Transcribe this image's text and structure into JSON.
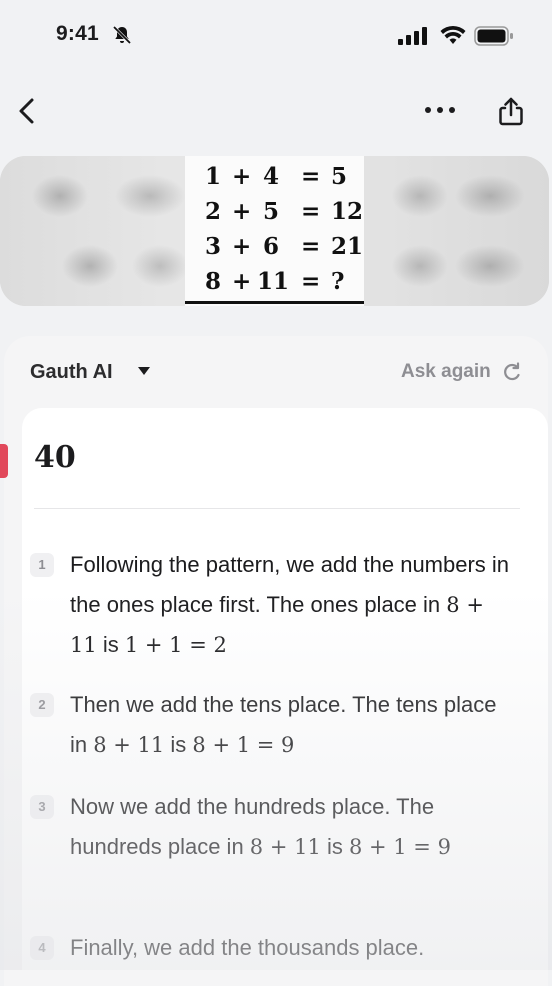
{
  "status_bar": {
    "time": "9:41"
  },
  "puzzle": {
    "lines": [
      {
        "a": "1",
        "op": "+",
        "b": "4",
        "eq": "=",
        "r": "5"
      },
      {
        "a": "2",
        "op": "+",
        "b": "5",
        "eq": "=",
        "r": "12"
      },
      {
        "a": "3",
        "op": "+",
        "b": "6",
        "eq": "=",
        "r": "21"
      },
      {
        "a": "8",
        "op": "+",
        "b": "11",
        "eq": "=",
        "r": "?"
      }
    ]
  },
  "answer_panel": {
    "model_name": "Gauth AI",
    "ask_again_label": "Ask again",
    "answer": "40",
    "steps": [
      {
        "num": "1",
        "parts": [
          "Following the pattern, we add the numbers in the ones place first. The ones place in ",
          "8 + 11",
          " is ",
          "1 + 1 = 2"
        ]
      },
      {
        "num": "2",
        "parts": [
          "Then we add the tens place. The tens place in ",
          "8 + 11",
          " is ",
          "8 + 1 = 9"
        ]
      },
      {
        "num": "3",
        "parts": [
          "Now we add the hundreds place. The hundreds place in ",
          "8 + 11",
          " is ",
          "8 + 1 = 9"
        ]
      },
      {
        "num": "4",
        "parts": [
          "Finally, we add the thousands place."
        ]
      }
    ]
  }
}
